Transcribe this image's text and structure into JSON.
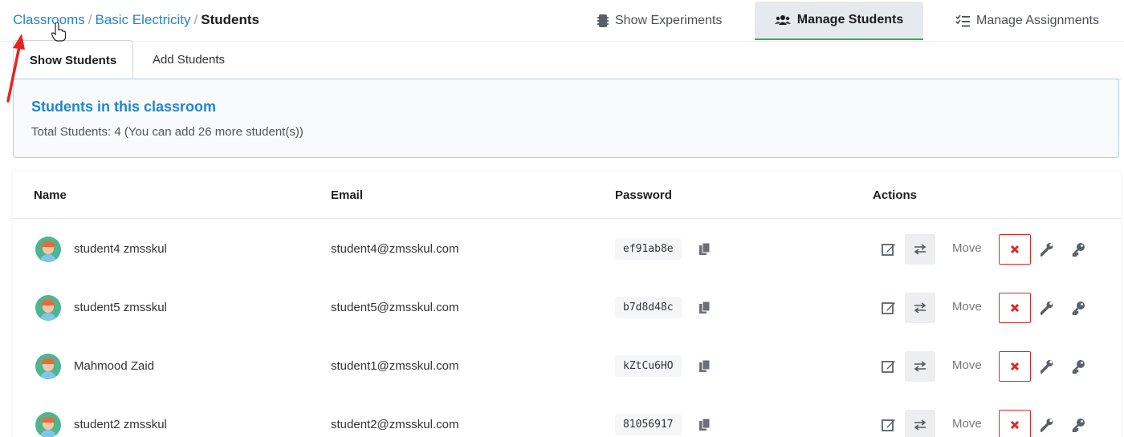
{
  "breadcrumb": {
    "items": [
      {
        "label": "Classrooms"
      },
      {
        "label": "Basic Electricity"
      }
    ],
    "separator": "/",
    "current": "Students"
  },
  "top_nav": {
    "show_experiments": "Show Experiments",
    "manage_students": "Manage Students",
    "manage_assignments": "Manage Assignments",
    "active": "Manage Students",
    "active_indicator_color": "#21ba45"
  },
  "sub_tabs": {
    "show_students": "Show Students",
    "add_students": "Add Students",
    "active": "Show Students"
  },
  "info": {
    "title": "Students in this classroom",
    "subtitle": "Total Students: 4 (You can add 26 more student(s))"
  },
  "table": {
    "headers": {
      "name": "Name",
      "email": "Email",
      "password": "Password",
      "actions": "Actions"
    },
    "move_label": "Move",
    "rows": [
      {
        "name": "student4 zmsskul",
        "email": "student4@zmsskul.com",
        "password": "ef91ab8e"
      },
      {
        "name": "student5 zmsskul",
        "email": "student5@zmsskul.com",
        "password": "b7d8d48c"
      },
      {
        "name": "Mahmood Zaid",
        "email": "student1@zmsskul.com",
        "password": "kZtCu6HO"
      },
      {
        "name": "student2 zmsskul",
        "email": "student2@zmsskul.com",
        "password": "81056917"
      }
    ]
  },
  "icons": {
    "show_experiments": "phone-icon",
    "manage_students": "users-icon",
    "manage_assignments": "tasks-icon",
    "copy": "copy-icon",
    "edit": "edit-icon",
    "swap": "exchange-icon",
    "delete": "close-icon",
    "wrench": "wrench-icon",
    "key": "key-icon"
  },
  "colors": {
    "link": "#2185d0",
    "delete": "#db2828",
    "annotation_arrow": "#e8231f"
  }
}
